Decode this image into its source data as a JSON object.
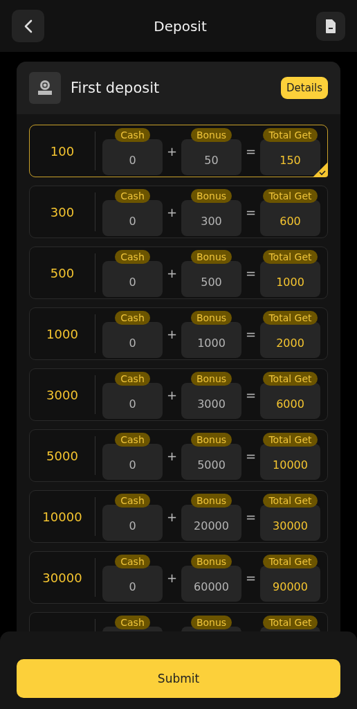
{
  "header": {
    "title": "Deposit"
  },
  "card": {
    "title": "First deposit",
    "details_button": "Details"
  },
  "rows": [
    {
      "amount": "100",
      "selected": true,
      "cash": {
        "label": "Cash",
        "value": "0"
      },
      "plus": "+",
      "bonus": {
        "label": "Bonus",
        "value": "50"
      },
      "equals": "=",
      "total": {
        "label": "Total Get",
        "value": "150"
      }
    },
    {
      "amount": "300",
      "selected": false,
      "cash": {
        "label": "Cash",
        "value": "0"
      },
      "plus": "+",
      "bonus": {
        "label": "Bonus",
        "value": "300"
      },
      "equals": "=",
      "total": {
        "label": "Total Get",
        "value": "600"
      }
    },
    {
      "amount": "500",
      "selected": false,
      "cash": {
        "label": "Cash",
        "value": "0"
      },
      "plus": "+",
      "bonus": {
        "label": "Bonus",
        "value": "500"
      },
      "equals": "=",
      "total": {
        "label": "Total Get",
        "value": "1000"
      }
    },
    {
      "amount": "1000",
      "selected": false,
      "cash": {
        "label": "Cash",
        "value": "0"
      },
      "plus": "+",
      "bonus": {
        "label": "Bonus",
        "value": "1000"
      },
      "equals": "=",
      "total": {
        "label": "Total Get",
        "value": "2000"
      }
    },
    {
      "amount": "3000",
      "selected": false,
      "cash": {
        "label": "Cash",
        "value": "0"
      },
      "plus": "+",
      "bonus": {
        "label": "Bonus",
        "value": "3000"
      },
      "equals": "=",
      "total": {
        "label": "Total Get",
        "value": "6000"
      }
    },
    {
      "amount": "5000",
      "selected": false,
      "cash": {
        "label": "Cash",
        "value": "0"
      },
      "plus": "+",
      "bonus": {
        "label": "Bonus",
        "value": "5000"
      },
      "equals": "=",
      "total": {
        "label": "Total Get",
        "value": "10000"
      }
    },
    {
      "amount": "10000",
      "selected": false,
      "cash": {
        "label": "Cash",
        "value": "0"
      },
      "plus": "+",
      "bonus": {
        "label": "Bonus",
        "value": "20000"
      },
      "equals": "=",
      "total": {
        "label": "Total Get",
        "value": "30000"
      }
    },
    {
      "amount": "30000",
      "selected": false,
      "cash": {
        "label": "Cash",
        "value": "0"
      },
      "plus": "+",
      "bonus": {
        "label": "Bonus",
        "value": "60000"
      },
      "equals": "=",
      "total": {
        "label": "Total Get",
        "value": "90000"
      }
    },
    {
      "selected": false,
      "cash": {
        "label": "Cash"
      },
      "bonus": {
        "label": "Bonus"
      },
      "total": {
        "label": "Total Get"
      }
    }
  ],
  "submit_button": "Submit"
}
